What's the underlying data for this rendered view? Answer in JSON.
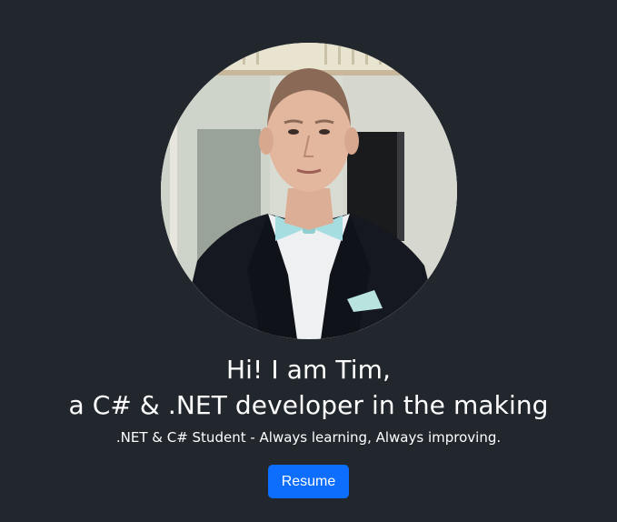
{
  "hero": {
    "avatar_alt": "Portrait of Tim",
    "greeting": "Hi! I am Tim,",
    "tagline": "a C# & .NET developer in the making",
    "subtitle": ".NET & C# Student - Always learning, Always improving.",
    "resume_label": "Resume"
  },
  "colors": {
    "background": "#22272e",
    "accent": "#0d6efd",
    "text": "#ffffff"
  }
}
